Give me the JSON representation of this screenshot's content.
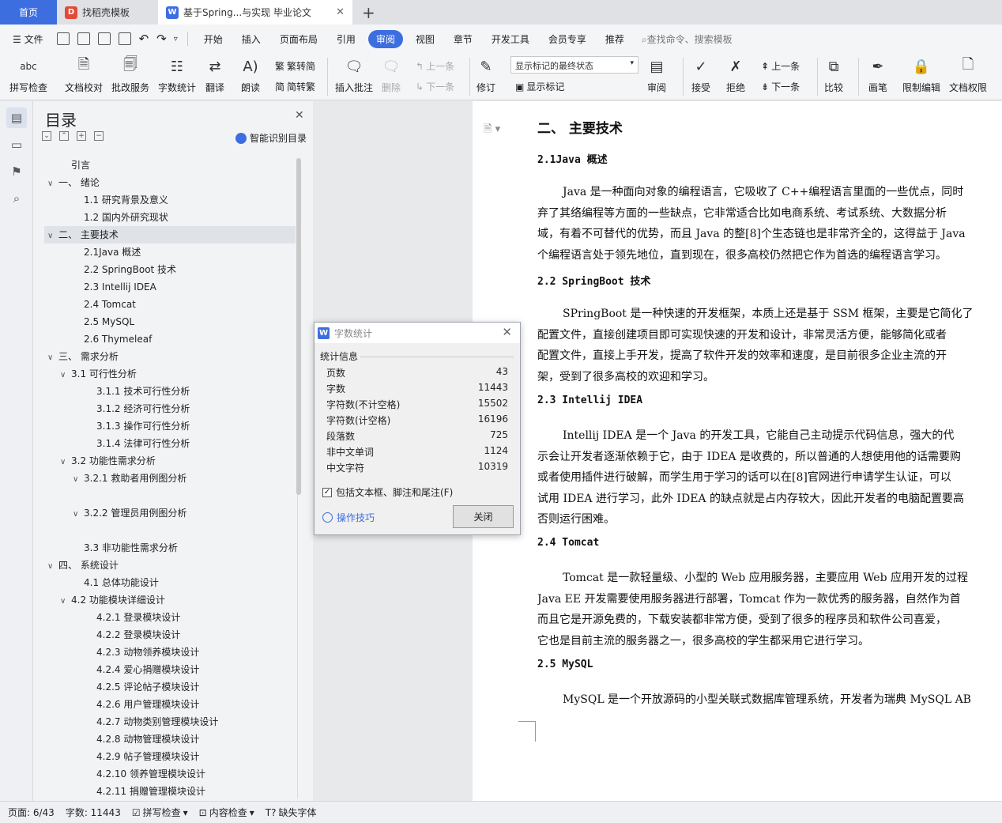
{
  "tabs": {
    "home": "首页",
    "template": "找稻壳模板",
    "doc": "基于Spring...与实现 毕业论文"
  },
  "menu": [
    "文件",
    "开始",
    "插入",
    "页面布局",
    "引用",
    "审阅",
    "视图",
    "章节",
    "开发工具",
    "会员专享",
    "推荐"
  ],
  "menu_active": "审阅",
  "search_placeholder": "查找命令、搜索模板",
  "ribbon": {
    "spell": "拼写检查",
    "proof": "文档校对",
    "batch": "批改服务",
    "wordcount": "字数统计",
    "translate": "翻译",
    "read": "朗读",
    "to_trad": "繁转简",
    "to_simp": "简转繁",
    "insert_comment": "插入批注",
    "delete": "删除",
    "prev": "上一条",
    "next": "下一条",
    "revise": "修订",
    "markup_state": "显示标记的最终状态",
    "show_markup": "显示标记",
    "review": "审阅",
    "accept": "接受",
    "reject": "拒绝",
    "prev2": "上一条",
    "next2": "下一条",
    "compare": "比较",
    "pen": "画笔",
    "restrict": "限制编辑",
    "permission": "文档权限"
  },
  "toc": {
    "title": "目录",
    "smart": "智能识别目录",
    "items": [
      {
        "label": "引言",
        "level": 1,
        "arrow": ""
      },
      {
        "label": "一、  绪论",
        "level": 0,
        "arrow": "v"
      },
      {
        "label": "1.1 研究背景及意义",
        "level": 2,
        "arrow": ""
      },
      {
        "label": "1.2 国内外研究现状",
        "level": 2,
        "arrow": ""
      },
      {
        "label": "二、  主要技术",
        "level": 0,
        "arrow": "v"
      },
      {
        "label": "2.1Java 概述",
        "level": 2,
        "arrow": ""
      },
      {
        "label": "2.2 SpringBoot 技术",
        "level": 2,
        "arrow": ""
      },
      {
        "label": "2.3 Intellij IDEA",
        "level": 2,
        "arrow": ""
      },
      {
        "label": "2.4 Tomcat",
        "level": 2,
        "arrow": ""
      },
      {
        "label": "2.5 MySQL",
        "level": 2,
        "arrow": ""
      },
      {
        "label": "2.6 Thymeleaf",
        "level": 2,
        "arrow": ""
      },
      {
        "label": "三、  需求分析",
        "level": 0,
        "arrow": "v"
      },
      {
        "label": "3.1 可行性分析",
        "level": 1,
        "arrow": "v"
      },
      {
        "label": "3.1.1  技术可行性分析",
        "level": 3,
        "arrow": ""
      },
      {
        "label": "3.1.2  经济可行性分析",
        "level": 3,
        "arrow": ""
      },
      {
        "label": "3.1.3  操作可行性分析",
        "level": 3,
        "arrow": ""
      },
      {
        "label": "3.1.4  法律可行性分析",
        "level": 3,
        "arrow": ""
      },
      {
        "label": "3.2  功能性需求分析",
        "level": 1,
        "arrow": "v"
      },
      {
        "label": "3.2.1 救助者用例图分析",
        "level": 2,
        "arrow": "v"
      },
      {
        "label": "",
        "level": 3,
        "arrow": ""
      },
      {
        "label": "3.2.2  管理员用例图分析",
        "level": 2,
        "arrow": "v"
      },
      {
        "label": "",
        "level": 3,
        "arrow": ""
      },
      {
        "label": "3.3  非功能性需求分析",
        "level": 2,
        "arrow": ""
      },
      {
        "label": "四、 系统设计",
        "level": 0,
        "arrow": "v"
      },
      {
        "label": "4.1  总体功能设计",
        "level": 2,
        "arrow": ""
      },
      {
        "label": "4.2  功能模块详细设计",
        "level": 1,
        "arrow": "v"
      },
      {
        "label": "4.2.1  登录模块设计",
        "level": 3,
        "arrow": ""
      },
      {
        "label": "4.2.2  登录模块设计",
        "level": 3,
        "arrow": ""
      },
      {
        "label": "4.2.3  动物领养模块设计",
        "level": 3,
        "arrow": ""
      },
      {
        "label": "4.2.4 爱心捐赠模块设计",
        "level": 3,
        "arrow": ""
      },
      {
        "label": "4.2.5 评论帖子模块设计",
        "level": 3,
        "arrow": ""
      },
      {
        "label": "4.2.6 用户管理模块设计",
        "level": 3,
        "arrow": ""
      },
      {
        "label": "4.2.7 动物类别管理模块设计",
        "level": 3,
        "arrow": ""
      },
      {
        "label": "4.2.8 动物管理模块设计",
        "level": 3,
        "arrow": ""
      },
      {
        "label": "4.2.9 帖子管理模块设计",
        "level": 3,
        "arrow": ""
      },
      {
        "label": "4.2.10 领养管理模块设计",
        "level": 3,
        "arrow": ""
      },
      {
        "label": "4.2.11 捐赠管理模块设计",
        "level": 3,
        "arrow": ""
      }
    ]
  },
  "doc": {
    "h1": "二、  主要技术",
    "sections": [
      {
        "heading": "2.1Java 概述",
        "lines": [
          "Java 是一种面向对象的编程语言，它吸收了 C++编程语言里面的一些优点，同时",
          "弃了其络编程等方面的一些缺点，它非常适合比如电商系统、考试系统、大数据分析",
          "域，有着不可替代的优势，而且 Java 的整[8]个生态链也是非常齐全的，这得益于 Java",
          "个编程语言处于领先地位，直到现在，很多高校仍然把它作为首选的编程语言学习。"
        ]
      },
      {
        "heading": "2.2 SpringBoot 技术",
        "lines": [
          "SPringBoot 是一种快速的开发框架，本质上还是基于 SSM 框架，主要是它简化了",
          "配置文件，直接创建项目即可实现快速的开发和设计，非常灵活方便，能够简化或者",
          "配置文件，直接上手开发，提高了软件开发的效率和速度，是目前很多企业主流的开",
          "架，受到了很多高校的欢迎和学习。"
        ]
      },
      {
        "heading": "2.3 Intellij IDEA",
        "lines": [
          "Intellij IDEA 是一个 Java 的开发工具，它能自己主动提示代码信息，强大的代",
          "示会让开发者逐渐依赖于它，由于 IDEA 是收费的，所以普通的人想使用他的话需要购",
          "或者使用插件进行破解，而学生用于学习的话可以在[8]官网进行申请学生认证，可以",
          "试用 IDEA 进行学习，此外 IDEA 的缺点就是占内存较大，因此开发者的电脑配置要高",
          "否则运行困难。"
        ]
      },
      {
        "heading": "2.4 Tomcat",
        "lines": [
          "Tomcat 是一款轻量级、小型的 Web 应用服务器，主要应用 Web 应用开发的过程",
          "Java EE 开发需要使用服务器进行部署，Tomcat 作为一款优秀的服务器，自然作为首",
          "而且它是开源免费的，下载安装都非常方便，受到了很多的程序员和软件公司喜爱，",
          "它也是目前主流的服务器之一，很多高校的学生都采用它进行学习。"
        ]
      },
      {
        "heading": "2.5 MySQL",
        "lines": [
          "MySQL 是一个开放源码的小型关联式数据库管理系统，开发者为瑞典 MySQL AB"
        ]
      }
    ]
  },
  "dialog": {
    "title": "字数统计",
    "section": "统计信息",
    "stats": [
      {
        "label": "页数",
        "value": "43"
      },
      {
        "label": "字数",
        "value": "11443"
      },
      {
        "label": "字符数(不计空格)",
        "value": "15502"
      },
      {
        "label": "字符数(计空格)",
        "value": "16196"
      },
      {
        "label": "段落数",
        "value": "725"
      },
      {
        "label": "非中文单词",
        "value": "1124"
      },
      {
        "label": "中文字符",
        "value": "10319"
      }
    ],
    "checkbox": "包括文本框、脚注和尾注(F)",
    "checked": true,
    "tips": "操作技巧",
    "close": "关闭"
  },
  "status": {
    "page": "页面: 6/43",
    "words": "字数: 11443",
    "spell": "拼写检查",
    "content": "内容检查",
    "font": "缺失字体"
  },
  "colors": {
    "accent": "#3d6ee0"
  }
}
